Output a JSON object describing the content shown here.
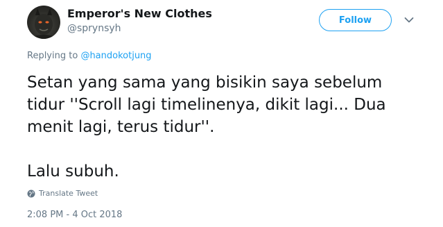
{
  "author": {
    "display_name": "Emperor's New Clothes",
    "screen_name": "@sprynsyh",
    "avatar_icon": "devil-face-avatar"
  },
  "follow_label": "Follow",
  "caret_icon": "chevron-down-icon",
  "reply": {
    "prefix": "Replying to ",
    "mention": "@handokotjung"
  },
  "tweet_text": "Setan yang sama yang bisikin saya sebelum\ntidur ''Scroll lagi timelinenya, dikit lagi... Dua\nmenit lagi, terus tidur''.\n\nLalu subuh.",
  "translate_label": "Translate Tweet",
  "timestamp": "2:08 PM - 4 Oct 2018",
  "colors": {
    "accent": "#1da1f2",
    "text": "#14171a",
    "muted": "#657786"
  }
}
